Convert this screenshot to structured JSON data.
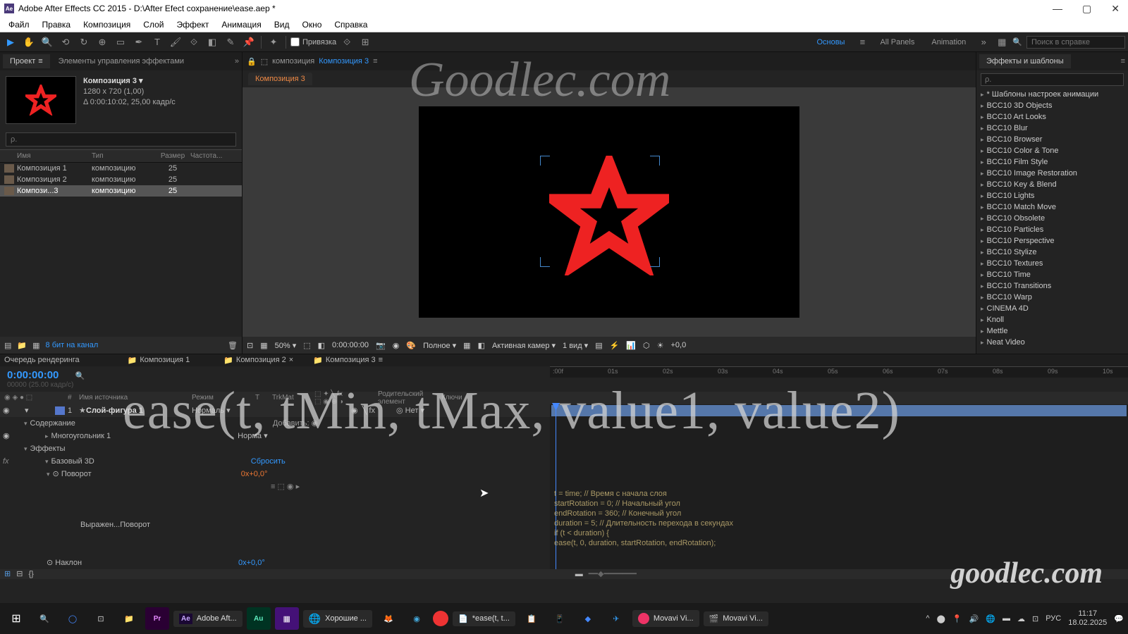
{
  "titlebar": {
    "app": "Adobe After Effects CC 2015",
    "path": "D:\\After Efect сохранение\\ease.aep *"
  },
  "menu": [
    "Файл",
    "Правка",
    "Композиция",
    "Слой",
    "Эффект",
    "Анимация",
    "Вид",
    "Окно",
    "Справка"
  ],
  "toolbar": {
    "snap_label": "Привязка",
    "workspaces": [
      "Основы",
      "All Panels",
      "Animation"
    ],
    "search_placeholder": "Поиск в справке"
  },
  "project": {
    "tab1": "Проект",
    "tab2": "Элементы управления эффектами",
    "comp_name": "Композиция 3",
    "comp_res": "1280 x 720 (1,00)",
    "comp_dur": "Δ 0:00:10:02, 25,00 кадр/с",
    "search_placeholder": "ρ.",
    "cols": [
      "Имя",
      "Тип",
      "Размер",
      "Частота..."
    ],
    "items": [
      {
        "name": "Композиция 1",
        "type": "композицию",
        "fps": "25",
        "sel": false
      },
      {
        "name": "Композиция 2",
        "type": "композицию",
        "fps": "25",
        "sel": false
      },
      {
        "name": "Компози...3",
        "type": "композицию",
        "fps": "25",
        "sel": true
      }
    ],
    "bits": "8 бит на канал"
  },
  "viewer": {
    "crumb_prefix": "композиция",
    "crumb_link": "Композиция 3",
    "subtab": "Композиция 3",
    "zoom": "50%",
    "timecode": "0:00:00:00",
    "res": "Полное",
    "camera": "Активная камер",
    "views": "1 вид",
    "exposure": "+0,0"
  },
  "effects": {
    "title": "Эффекты и шаблоны",
    "search_placeholder": "ρ.",
    "items": [
      "* Шаблоны настроек анимации",
      "BCC10 3D Objects",
      "BCC10 Art Looks",
      "BCC10 Blur",
      "BCC10 Browser",
      "BCC10 Color & Tone",
      "BCC10 Film Style",
      "BCC10 Image Restoration",
      "BCC10 Key & Blend",
      "BCC10 Lights",
      "BCC10 Match Move",
      "BCC10 Obsolete",
      "BCC10 Particles",
      "BCC10 Perspective",
      "BCC10 Stylize",
      "BCC10 Textures",
      "BCC10 Time",
      "BCC10 Transitions",
      "BCC10 Warp",
      "CINEMA 4D",
      "Knoll",
      "Mettle",
      "Neat Video"
    ]
  },
  "timeline": {
    "tab_queue": "Очередь рендеринга",
    "tab_c1": "Композиция 1",
    "tab_c2": "Композиция 2",
    "tab_c3": "Композиция 3",
    "timecode": "0:00:00:00",
    "frames": "00000 (25.00 кадр/с)",
    "col_num": "#",
    "col_src": "Имя источника",
    "col_mode": "Режим",
    "col_t": "T",
    "col_trkmat": "TrkMat",
    "col_parent": "Родительский элемент",
    "col_keys": "Ключи",
    "ruler": [
      ":00f",
      "01s",
      "02s",
      "03s",
      "04s",
      "05s",
      "06s",
      "07s",
      "08s",
      "09s",
      "10s"
    ],
    "layer_num": "1",
    "layer_name": "Слой-фигура 1",
    "layer_mode": "Нормаль",
    "parent_none": "Нет",
    "row_content": "Содержание",
    "row_add": "Добавить:",
    "row_poly": "Многоугольник 1",
    "row_norm": "Норма",
    "row_fx": "Эффекты",
    "row_basic3d": "Базовый 3D",
    "row_reset": "Сбросить",
    "row_rotate": "Поворот",
    "row_rotate_val": "0x+0,0°",
    "row_expr_label": "Выражен...Поворот",
    "row_tilt": "Наклон",
    "row_tilt_val": "0x+0,0°",
    "expression": {
      "l1": "t = time; // Время с начала слоя",
      "l2": "startRotation = 0; // Начальный угол",
      "l3": "endRotation = 360; // Конечный угол",
      "l4": "duration = 5; // Длительность перехода в секундах",
      "l5": "",
      "l6": "if (t < duration) {",
      "l7": "  ease(t, 0, duration, startRotation, endRotation);"
    }
  },
  "overlay": {
    "wm1": "Goodlec.com",
    "wm2": "ease(t, tMin, tMax, value1, value2)",
    "wm3": "goodlec.com"
  },
  "taskbar": {
    "apps": [
      {
        "label": "Adobe Aft..."
      },
      {
        "label": "Хорошие ..."
      },
      {
        "label": "*ease(t, t..."
      },
      {
        "label": "Movavi Vi..."
      },
      {
        "label": "Movavi Vi..."
      }
    ],
    "lang": "РУС",
    "time": "11:17",
    "date": "18.02.2025"
  }
}
